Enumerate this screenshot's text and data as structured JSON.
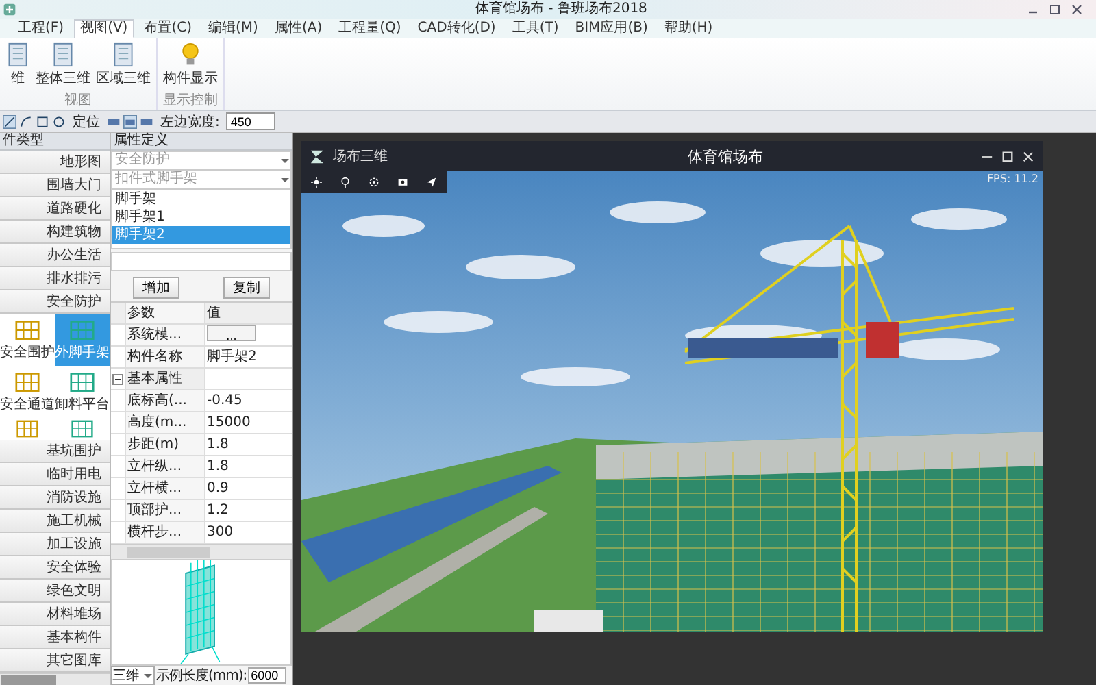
{
  "window": {
    "title": "体育馆场布 - 鲁班场布2018"
  },
  "menu_tabs": [
    {
      "label": "工程(F)",
      "selected": false
    },
    {
      "label": "视图(V)",
      "selected": true
    },
    {
      "label": "布置(C)",
      "selected": false
    },
    {
      "label": "编辑(M)",
      "selected": false
    },
    {
      "label": "属性(A)",
      "selected": false
    },
    {
      "label": "工程量(Q)",
      "selected": false
    },
    {
      "label": "CAD转化(D)",
      "selected": false
    },
    {
      "label": "工具(T)",
      "selected": false
    },
    {
      "label": "BIM应用(B)",
      "selected": false
    },
    {
      "label": "帮助(H)",
      "selected": false
    }
  ],
  "ribbon": {
    "groups": [
      {
        "label": "视图",
        "buttons": [
          "维",
          "整体三维",
          "区域三维"
        ]
      },
      {
        "label": "显示控制",
        "buttons": [
          "构件显示"
        ]
      }
    ]
  },
  "toolbar": {
    "position_label": "定位",
    "width_label": "左边宽度:",
    "width_value": "450"
  },
  "category_panel": {
    "title": "件类型",
    "items": [
      {
        "label": "地形图"
      },
      {
        "label": "围墙大门"
      },
      {
        "label": "道路硬化"
      },
      {
        "label": "构建筑物"
      },
      {
        "label": "办公生活"
      },
      {
        "label": "排水排污"
      },
      {
        "label": "安全防护",
        "children": [
          {
            "label": "安全围护",
            "selected": false
          },
          {
            "label": "外脚手架",
            "selected": true
          },
          {
            "label": "安全通道",
            "selected": false
          },
          {
            "label": "卸料平台",
            "selected": false
          },
          {
            "selected": false
          },
          {
            "selected": false
          }
        ]
      },
      {
        "label": "基坑围护"
      },
      {
        "label": "临时用电"
      },
      {
        "label": "消防设施"
      },
      {
        "label": "施工机械"
      },
      {
        "label": "加工设施"
      },
      {
        "label": "安全体验"
      },
      {
        "label": "绿色文明"
      },
      {
        "label": "材料堆场"
      },
      {
        "label": "基本构件"
      },
      {
        "label": "其它图库"
      }
    ]
  },
  "properties_panel": {
    "title": "属性定义",
    "category_select": "安全防护",
    "type_select": "扣件式脚手架",
    "items": [
      {
        "label": "脚手架",
        "selected": false
      },
      {
        "label": "脚手架1",
        "selected": false
      },
      {
        "label": "脚手架2",
        "selected": true
      }
    ],
    "buttons": [
      "增加",
      "复制"
    ],
    "grid": {
      "columns": [
        "参数",
        "值"
      ],
      "rows": [
        {
          "kind": "button",
          "name": "系统模...",
          "value": "..."
        },
        {
          "kind": "text",
          "name": "构件名称",
          "value": "脚手架2"
        },
        {
          "kind": "group",
          "name": "基本属性",
          "expanded": true
        },
        {
          "kind": "text",
          "name": "底标高(...",
          "value": "-0.45"
        },
        {
          "kind": "text",
          "name": "高度(m...",
          "value": "15000"
        },
        {
          "kind": "text",
          "name": "步距(m)",
          "value": "1.8"
        },
        {
          "kind": "text",
          "name": "立杆纵...",
          "value": "1.8"
        },
        {
          "kind": "text",
          "name": "立杆横...",
          "value": "0.9"
        },
        {
          "kind": "text",
          "name": "顶部护...",
          "value": "1.2"
        },
        {
          "kind": "text",
          "name": "横杆步...",
          "value": "300"
        }
      ]
    },
    "preview": {
      "view_select": "三维",
      "length_label": "示例长度(mm):",
      "length_value": "6000"
    }
  },
  "viewer": {
    "logo_text": "场布三维",
    "title": "体育馆场布",
    "fps": "FPS: 11.2"
  }
}
